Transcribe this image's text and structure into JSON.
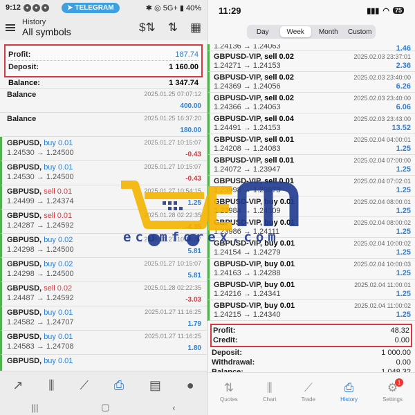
{
  "left": {
    "status": {
      "time": "9:12",
      "pill": "TELEGRAM",
      "right": "✱ ◎ 5G+ ▮ 40%"
    },
    "header": {
      "title_small": "History",
      "title": "All symbols"
    },
    "summary": {
      "profit_label": "Profit:",
      "profit_value": "187.74",
      "deposit_label": "Deposit:",
      "deposit_value": "1 160.00"
    },
    "balance": {
      "label": "Balance:",
      "value": "1 347.74"
    },
    "entries": [
      {
        "symbol": "Balance",
        "type": "",
        "prices": "",
        "date": "2025.01.25 07:07:12",
        "profit": "400.00",
        "kind": "balance"
      },
      {
        "symbol": "Balance",
        "type": "",
        "prices": "",
        "date": "2025.01.25 16:37:20",
        "profit": "180.00",
        "kind": "balance"
      },
      {
        "symbol": "GBPUSD,",
        "type": "buy 0.01",
        "prices": "1.24530 → 1.24500",
        "date": "2025.01.27 10:15:07",
        "profit": "-0.43",
        "kind": "deal"
      },
      {
        "symbol": "GBPUSD,",
        "type": "buy 0.01",
        "prices": "1.24530 → 1.24500",
        "date": "2025.01.27 10:15:07",
        "profit": "-0.43",
        "kind": "deal"
      },
      {
        "symbol": "GBPUSD,",
        "type": "sell 0.01",
        "prices": "1.24499 → 1.24374",
        "date": "2025.01.27 10:54:15",
        "profit": "1.25",
        "kind": "deal"
      },
      {
        "symbol": "GBPUSD,",
        "type": "sell 0.01",
        "prices": "1.24287 → 1.24592",
        "date": "2025.01.28 02:22:35",
        "profit": "-4.35",
        "kind": "deal"
      },
      {
        "symbol": "GBPUSD,",
        "type": "buy 0.02",
        "prices": "1.24298 → 1.24500",
        "date": "2025.01.27 10:15:07",
        "profit": "5.81",
        "kind": "deal"
      },
      {
        "symbol": "GBPUSD,",
        "type": "buy 0.02",
        "prices": "1.24298 → 1.24500",
        "date": "2025.01.27 10:15:07",
        "profit": "5.81",
        "kind": "deal"
      },
      {
        "symbol": "GBPUSD,",
        "type": "sell 0.02",
        "prices": "1.24487 → 1.24592",
        "date": "2025.01.28 02:22:35",
        "profit": "-3.03",
        "kind": "deal"
      },
      {
        "symbol": "GBPUSD,",
        "type": "buy 0.01",
        "prices": "1.24582 → 1.24707",
        "date": "2025.01.27 11:16:25",
        "profit": "1.79",
        "kind": "deal"
      },
      {
        "symbol": "GBPUSD,",
        "type": "buy 0.01",
        "prices": "1.24583 → 1.24708",
        "date": "2025.01.27 11:16:25",
        "profit": "1.80",
        "kind": "deal"
      },
      {
        "symbol": "GBPUSD,",
        "type": "buy 0.01",
        "prices": "",
        "date": "",
        "profit": "",
        "kind": "deal"
      }
    ]
  },
  "right": {
    "status": {
      "time": "11:29",
      "battery": "75"
    },
    "tabs": [
      "Day",
      "Week",
      "Month",
      "Custom"
    ],
    "first_cut": {
      "prices": "1.24136 → 1.24063",
      "profit": "1.46"
    },
    "entries": [
      {
        "symbol": "GBPUSD-VIP,",
        "type": "sell 0.02",
        "prices": "1.24271 → 1.24153",
        "date": "2025.02.03 23:37:01",
        "profit": "2.36"
      },
      {
        "symbol": "GBPUSD-VIP,",
        "type": "sell 0.02",
        "prices": "1.24369 → 1.24056",
        "date": "2025.02.03 23:40:00",
        "profit": "6.26"
      },
      {
        "symbol": "GBPUSD-VIP,",
        "type": "sell 0.02",
        "prices": "1.24366 → 1.24063",
        "date": "2025.02.03 23:40:00",
        "profit": "6.06"
      },
      {
        "symbol": "GBPUSD-VIP,",
        "type": "sell 0.04",
        "prices": "1.24491 → 1.24153",
        "date": "2025.02.03 23:43:00",
        "profit": "13.52"
      },
      {
        "symbol": "GBPUSD-VIP,",
        "type": "sell 0.01",
        "prices": "1.24208 → 1.24083",
        "date": "2025.02.04 04:00:01",
        "profit": "1.25"
      },
      {
        "symbol": "GBPUSD-VIP,",
        "type": "sell 0.01",
        "prices": "1.24072 → 1.23947",
        "date": "2025.02.04 07:00:00",
        "profit": "1.25"
      },
      {
        "symbol": "GBPUSD-VIP,",
        "type": "sell 0.01",
        "prices": "1.23998 → 1.23873",
        "date": "2025.02.04 07:02:01",
        "profit": "1.25"
      },
      {
        "symbol": "GBPUSD-VIP,",
        "type": "buy 0.01",
        "prices": "1.23984 → 1.24109",
        "date": "2025.02.04 08:00:01",
        "profit": "1.25"
      },
      {
        "symbol": "GBPUSD-VIP,",
        "type": "buy 0.01",
        "prices": "1.23986 → 1.24111",
        "date": "2025.02.04 08:00:02",
        "profit": "1.25"
      },
      {
        "symbol": "GBPUSD-VIP,",
        "type": "buy 0.01",
        "prices": "1.24154 → 1.24279",
        "date": "2025.02.04 10:00:02",
        "profit": "1.25"
      },
      {
        "symbol": "GBPUSD-VIP,",
        "type": "buy 0.01",
        "prices": "1.24163 → 1.24288",
        "date": "2025.02.04 10:00:03",
        "profit": "1.25"
      },
      {
        "symbol": "GBPUSD-VIP,",
        "type": "buy 0.01",
        "prices": "1.24216 → 1.24341",
        "date": "2025.02.04 11:00:01",
        "profit": "1.25"
      },
      {
        "symbol": "GBPUSD-VIP,",
        "type": "buy 0.01",
        "prices": "1.24215 → 1.24340",
        "date": "2025.02.04 11:00:02",
        "profit": "1.25"
      }
    ],
    "summary": {
      "profit_label": "Profit:",
      "profit_value": "48.32",
      "credit_label": "Credit:",
      "credit_value": "0.00"
    },
    "rest": [
      {
        "label": "Deposit:",
        "value": "1 000.00"
      },
      {
        "label": "Withdrawal:",
        "value": "0.00"
      },
      {
        "label": "Balance:",
        "value": "1 048.32"
      }
    ],
    "bottom_tabs": [
      "Quotes",
      "Chart",
      "Trade",
      "History",
      "Settings"
    ],
    "settings_badge": "1"
  },
  "watermark": {
    "text": "ecomforex.com"
  },
  "colors": {
    "accent": "#2b7fd4",
    "loss": "#d9363e",
    "deal_bar": "#4fb24f",
    "highlight_box": "#d9363e"
  }
}
